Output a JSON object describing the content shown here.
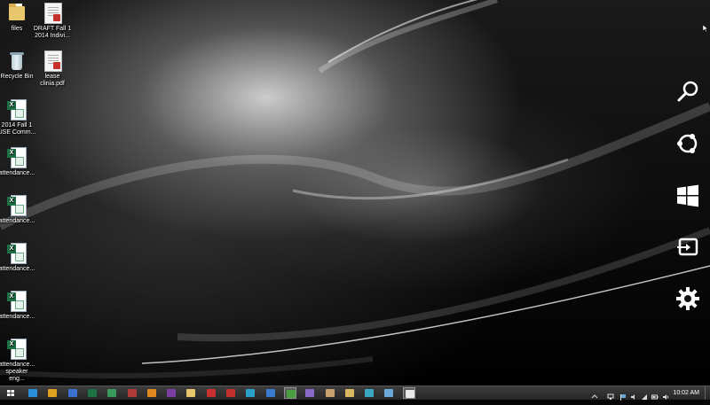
{
  "desktop_icons": [
    {
      "label": "files",
      "label2": "",
      "type": "folder"
    },
    {
      "label": "DRAFT Fall 1",
      "label2": "2014 Indivi...",
      "type": "pdf"
    },
    {
      "label": "Recycle Bin",
      "label2": "",
      "type": "recycle-bin"
    },
    {
      "label": "lease",
      "label2": "clinia.pdf",
      "type": "pdf"
    },
    {
      "label": "2014 Fall 1",
      "label2": "USE Comm...",
      "type": "excel"
    },
    {
      "label": "attendance...",
      "label2": "",
      "type": "excel"
    },
    {
      "label": "attendance...",
      "label2": "",
      "type": "excel"
    },
    {
      "label": "attendance...",
      "label2": "",
      "type": "excel"
    },
    {
      "label": "attendance...",
      "label2": "",
      "type": "excel"
    },
    {
      "label": "attendance...",
      "label2": "speaker eng...",
      "type": "excel"
    }
  ],
  "charms": [
    "search-icon",
    "share-icon",
    "start-icon",
    "devices-icon",
    "settings-icon"
  ],
  "taskbar": {
    "start": "start-button",
    "apps": [
      {
        "name": "internet-explorer",
        "color": "#2a8fd8"
      },
      {
        "name": "chrome",
        "color": "#e0a020"
      },
      {
        "name": "app-blue",
        "color": "#3b6fd0"
      },
      {
        "name": "excel",
        "color": "#1e7145"
      },
      {
        "name": "excel-2",
        "color": "#3a9a5a"
      },
      {
        "name": "access",
        "color": "#b03a3a"
      },
      {
        "name": "app-orange",
        "color": "#e08a20"
      },
      {
        "name": "onenote",
        "color": "#7a3ea0"
      },
      {
        "name": "file-explorer",
        "color": "#e8c66b"
      },
      {
        "name": "app-red",
        "color": "#c83030"
      },
      {
        "name": "acrobat",
        "color": "#c4302b"
      },
      {
        "name": "app-cyan",
        "color": "#2aa0c8"
      },
      {
        "name": "app-blue-2",
        "color": "#3a7ad0"
      },
      {
        "name": "app-green",
        "color": "#4aa040"
      },
      {
        "name": "app-purple",
        "color": "#8a6ac8"
      },
      {
        "name": "app-tan",
        "color": "#c8a070"
      },
      {
        "name": "app-folder",
        "color": "#d8b860"
      },
      {
        "name": "app-teal",
        "color": "#3aa8c0"
      },
      {
        "name": "app-gem",
        "color": "#6aa8d8"
      },
      {
        "name": "active-window",
        "color": "#e8e8e8"
      }
    ],
    "tray": [
      "action-center-icon",
      "network-icon",
      "flag-icon",
      "volume-icon",
      "wifi-icon",
      "battery-icon"
    ],
    "clock": "10:02 AM"
  },
  "colors": {
    "taskbar": "#2e2e2e",
    "wallpaper_accent": "#dcdcdc"
  }
}
